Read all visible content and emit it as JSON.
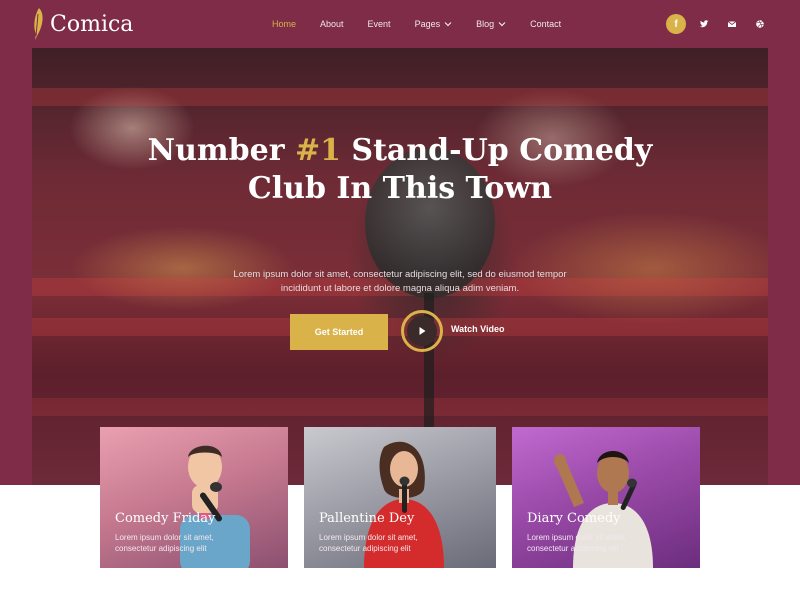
{
  "brand": {
    "name": "Comica"
  },
  "nav": {
    "items": [
      {
        "label": "Home",
        "active": true
      },
      {
        "label": "About"
      },
      {
        "label": "Event"
      },
      {
        "label": "Pages",
        "has_dropdown": true
      },
      {
        "label": "Blog",
        "has_dropdown": true
      },
      {
        "label": "Contact"
      }
    ]
  },
  "social": {
    "icons": [
      "facebook-icon",
      "twitter-icon",
      "mail-icon",
      "dribbble-icon"
    ],
    "facebook_glyph": "f"
  },
  "hero": {
    "title_prefix": "Number ",
    "title_highlight": "#1",
    "title_line1_rest": " Stand-Up Comedy",
    "title_line2": "Club In This Town",
    "description_line1": "Lorem ipsum dolor sit amet, consectetur adipiscing elit, sed do eiusmod tempor",
    "description_line2": "incididunt ut labore et dolore magna aliqua adim veniam.",
    "primary_button": "Get Started",
    "secondary_button": "Watch Video"
  },
  "cards": [
    {
      "title": "Comedy Friday",
      "desc_line1": "Lorem ipsum dolor sit amet,",
      "desc_line2": "consectetur adipiscing elit"
    },
    {
      "title": "Pallentine Dey",
      "desc_line1": "Lorem ipsum dolor sit amet,",
      "desc_line2": "consectetur adipiscing elit"
    },
    {
      "title": "Diary Comedy",
      "desc_line1": "Lorem ipsum dolor sit amet,",
      "desc_line2": "consectetur adipiscing elit"
    }
  ],
  "colors": {
    "brand_maroon": "#7e2c47",
    "accent_gold": "#d9b24a",
    "white": "#ffffff"
  }
}
